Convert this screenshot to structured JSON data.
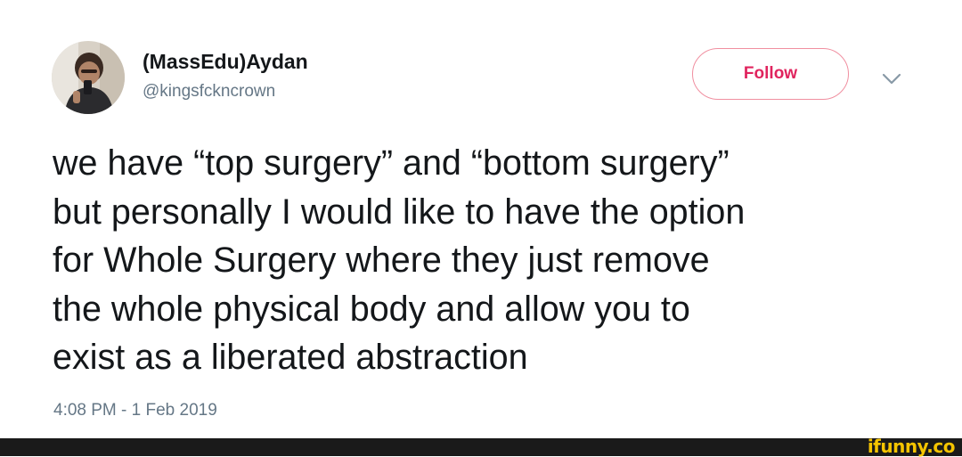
{
  "tweet": {
    "display_name": "(MassEdu)Aydan",
    "handle": "@kingsfckncrown",
    "follow_label": "Follow",
    "text_lines": [
      "we have “top surgery” and “bottom surgery”",
      "but personally I would like to have the option",
      "for Whole Surgery where they just remove",
      "the whole physical body and allow you to",
      "exist as a liberated abstraction"
    ],
    "timestamp": "4:08 PM - 1 Feb 2019",
    "icons": {
      "avatar": "profile-photo",
      "menu": "chevron-down-icon"
    },
    "colors": {
      "follow_accent": "#e0245e",
      "text": "#14171a",
      "muted": "#657786"
    }
  },
  "watermark": {
    "text": "ifunny.co",
    "color": "#f5c400",
    "bar_color": "#1a1a1a"
  }
}
